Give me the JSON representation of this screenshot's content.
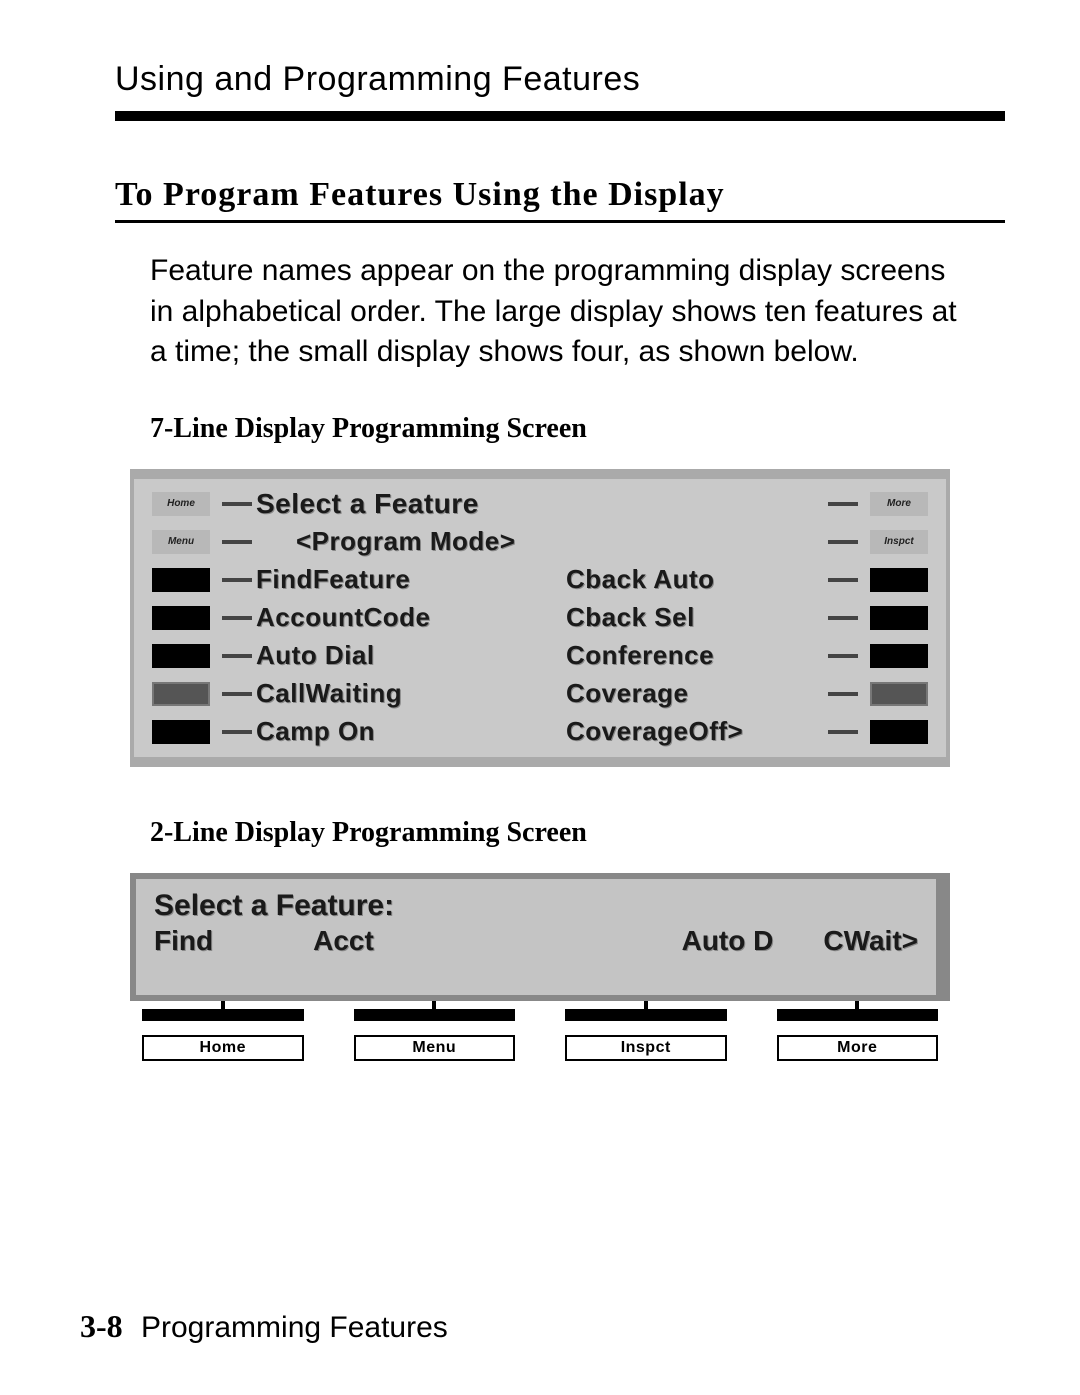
{
  "header": "Using and Programming Features",
  "section_title": "To Program Features Using the Display",
  "paragraph": "Feature names appear on the programming display screens in alphabetical order. The large display shows ten features at a time; the small display shows four, as shown below.",
  "display7": {
    "heading": "7-Line Display Programming Screen",
    "sideLabels": {
      "home": "Home",
      "menu": "Menu",
      "more": "More",
      "inspect": "Inspct"
    },
    "lines": {
      "title": "Select a Feature",
      "mode": "<Program Mode>",
      "r1l": "FindFeature",
      "r1r": "Cback Auto",
      "r2l": "AccountCode",
      "r2r": "Cback Sel",
      "r3l": "Auto Dial",
      "r3r": "Conference",
      "r4l": "CallWaiting",
      "r4r": "Coverage",
      "r5l": "Camp On",
      "r5r": "CoverageOff>"
    }
  },
  "display2": {
    "heading": "2-Line Display Programming Screen",
    "title": "Select a Feature:",
    "opts": {
      "a": "Find",
      "b": "Acct",
      "c": "Auto D",
      "d": "CWait>"
    },
    "buttons": {
      "a": "Home",
      "b": "Menu",
      "c": "Inspct",
      "d": "More"
    }
  },
  "footer": {
    "page": "3-8",
    "label": "Programming Features"
  }
}
